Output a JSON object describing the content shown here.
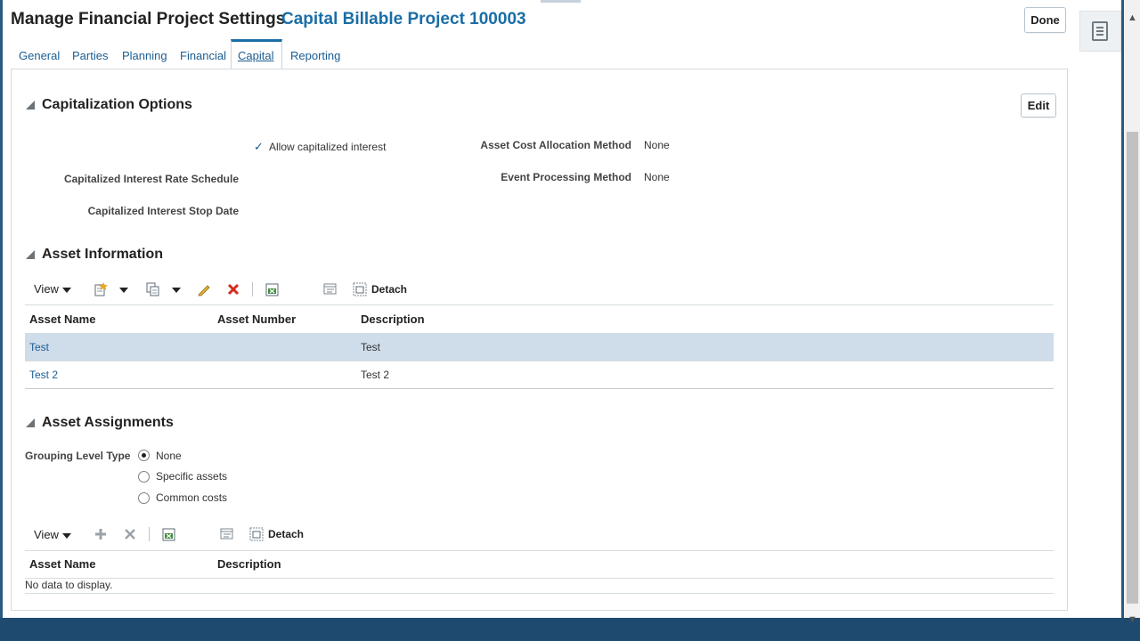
{
  "header": {
    "title": "Manage Financial Project Settings",
    "subtitle": "Capital Billable Project 100003",
    "done_label": "Done"
  },
  "tabs": [
    {
      "label": "General"
    },
    {
      "label": "Parties"
    },
    {
      "label": "Planning"
    },
    {
      "label": "Financial"
    },
    {
      "label": "Capital",
      "active": true
    },
    {
      "label": "Reporting"
    }
  ],
  "capitalization": {
    "title": "Capitalization Options",
    "edit_label": "Edit",
    "allow_interest_label": "Allow capitalized interest",
    "allow_interest_checked": true,
    "rate_schedule_label": "Capitalized Interest Rate Schedule",
    "rate_schedule_value": "",
    "stop_date_label": "Capitalized Interest Stop Date",
    "stop_date_value": "",
    "cost_alloc_label": "Asset Cost Allocation Method",
    "cost_alloc_value": "None",
    "event_label": "Event Processing Method",
    "event_value": "None"
  },
  "asset_info": {
    "title": "Asset Information",
    "view_label": "View",
    "detach_label": "Detach",
    "columns": [
      "Asset Name",
      "Asset Number",
      "Description"
    ],
    "rows": [
      {
        "name": "Test",
        "number": "",
        "description": "Test",
        "selected": true
      },
      {
        "name": "Test 2",
        "number": "",
        "description": "Test 2",
        "selected": false
      }
    ]
  },
  "asset_assignments": {
    "title": "Asset Assignments",
    "grouping_label": "Grouping Level Type",
    "options": [
      {
        "label": "None",
        "selected": true
      },
      {
        "label": "Specific assets",
        "selected": false
      },
      {
        "label": "Common costs",
        "selected": false
      }
    ],
    "view_label": "View",
    "detach_label": "Detach",
    "columns": [
      "Asset Name",
      "Description"
    ],
    "empty_text": "No data to display."
  },
  "colors": {
    "link": "#1a5d92",
    "accent": "#1a6ea6",
    "selected_row": "#cfdcea",
    "bottom_bar": "#1f4a6f"
  }
}
